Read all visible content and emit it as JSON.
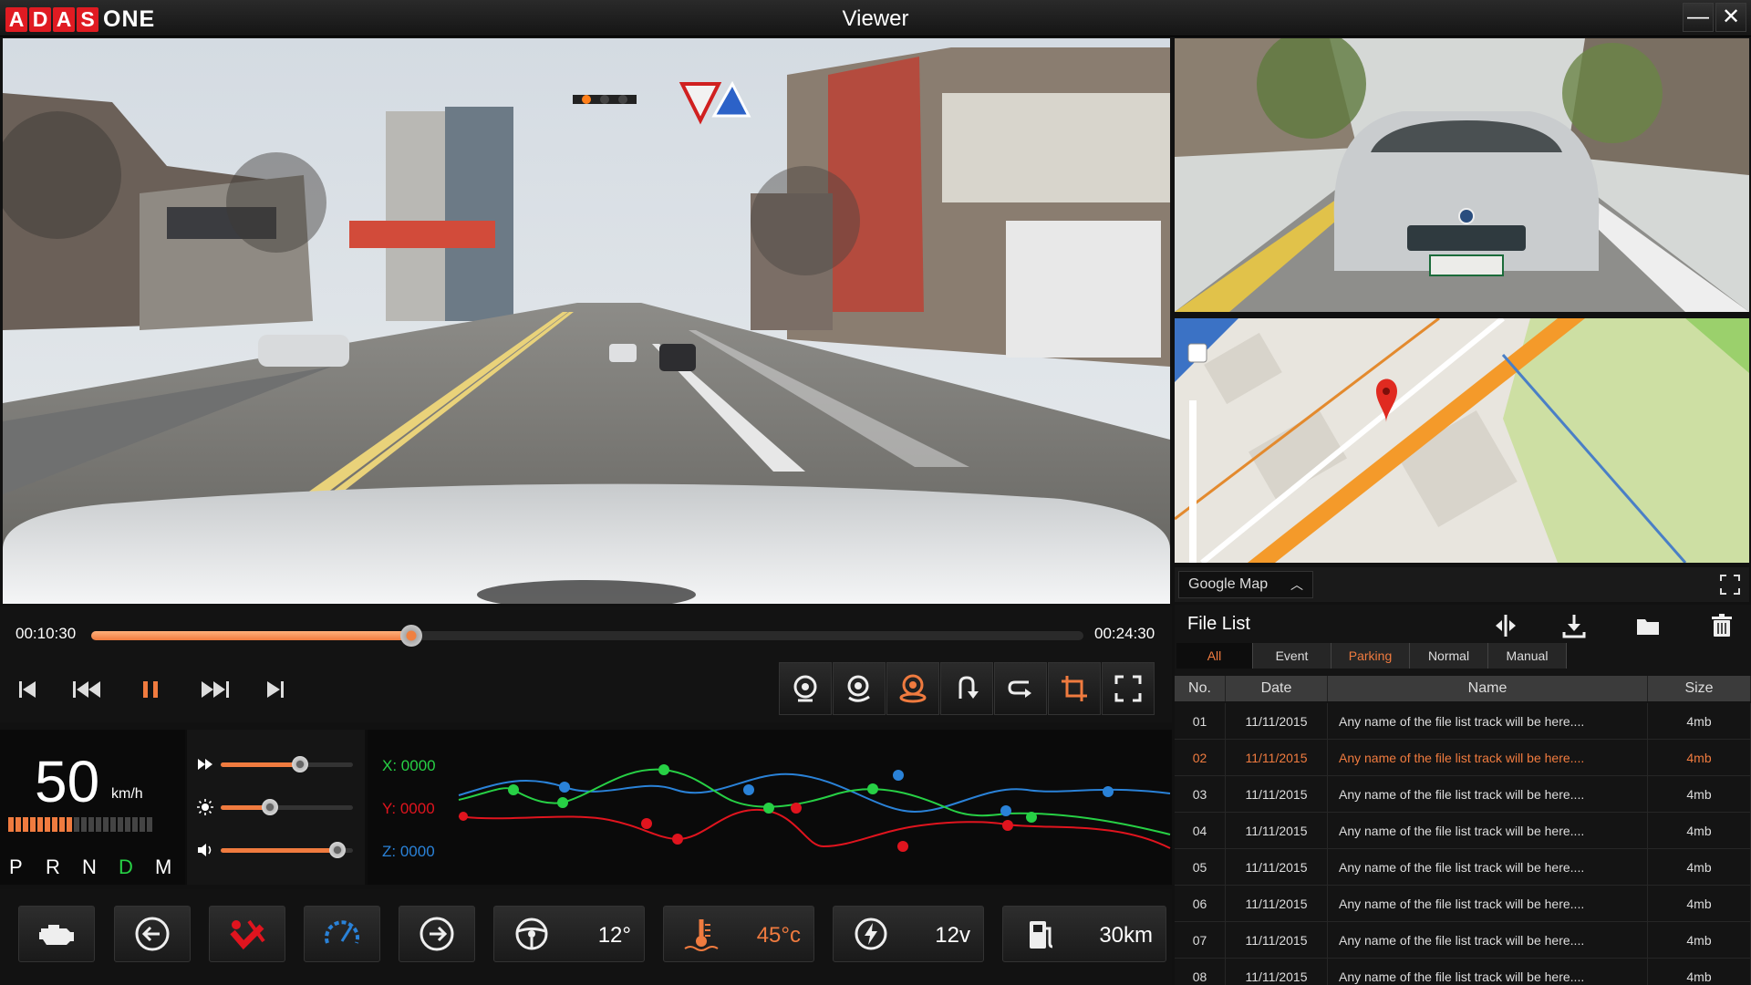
{
  "app": {
    "logo_letters": [
      "A",
      "D",
      "A",
      "S"
    ],
    "logo_word": "ONE",
    "title": "Viewer",
    "minimize": "—",
    "close": "✕"
  },
  "map": {
    "source_label": "Google Map"
  },
  "playback": {
    "current_time": "00:10:30",
    "total_time": "00:24:30",
    "progress": 0.323
  },
  "speed": {
    "value": "50",
    "unit": "km/h",
    "level_segments_on": 9,
    "level_segments_total": 20
  },
  "gears": [
    "P",
    "R",
    "N",
    "D",
    "M"
  ],
  "active_gear": "D",
  "sliders": {
    "speed": 0.6,
    "brightness": 0.37,
    "volume": 0.88
  },
  "gsensor": {
    "x_label": "X: 0000",
    "y_label": "Y: 0000",
    "z_label": "Z: 0000",
    "colors": {
      "x": "#27d045",
      "y": "#e0141e",
      "z": "#2a82d8"
    }
  },
  "indicators": {
    "steering_angle": "12°",
    "temperature": "45°c",
    "voltage": "12v",
    "fuel_range": "30km"
  },
  "file_list": {
    "title": "File List",
    "tabs": [
      "All",
      "Event",
      "Parking",
      "Normal",
      "Manual"
    ],
    "active_tab": "All",
    "columns": [
      "No.",
      "Date",
      "Name",
      "Size"
    ],
    "rows": [
      {
        "no": "01",
        "date": "11/11/2015",
        "name": "Any name of the file list track will be here....",
        "size": "4mb"
      },
      {
        "no": "02",
        "date": "11/11/2015",
        "name": "Any name of the file list track will be here....",
        "size": "4mb"
      },
      {
        "no": "03",
        "date": "11/11/2015",
        "name": "Any name of the file list track will be here....",
        "size": "4mb"
      },
      {
        "no": "04",
        "date": "11/11/2015",
        "name": "Any name of the file list track will be here....",
        "size": "4mb"
      },
      {
        "no": "05",
        "date": "11/11/2015",
        "name": "Any name of the file list track will be here....",
        "size": "4mb"
      },
      {
        "no": "06",
        "date": "11/11/2015",
        "name": "Any name of the file list track will be here....",
        "size": "4mb"
      },
      {
        "no": "07",
        "date": "11/11/2015",
        "name": "Any name of the file list track will be here....",
        "size": "4mb"
      },
      {
        "no": "08",
        "date": "11/11/2015",
        "name": "Any name of the file list track will be here....",
        "size": "4mb"
      }
    ],
    "selected_row": "02"
  },
  "accent_color": "#f07b3f"
}
